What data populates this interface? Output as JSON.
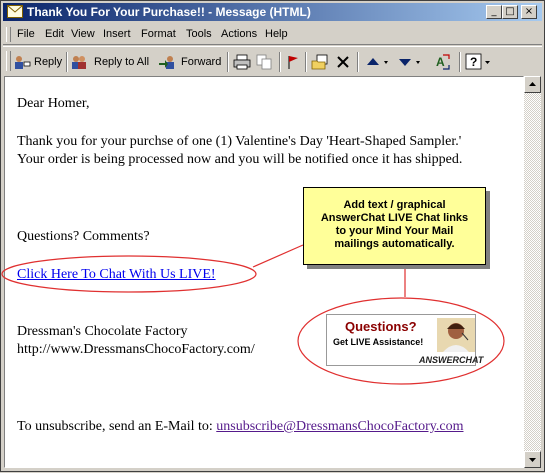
{
  "window": {
    "title": "Thank You For Your Purchase!! - Message (HTML)",
    "controls": {
      "minimize": "_",
      "maximize": "□",
      "close": "×"
    }
  },
  "menu": {
    "items": [
      {
        "label": "File"
      },
      {
        "label": "Edit"
      },
      {
        "label": "View"
      },
      {
        "label": "Insert"
      },
      {
        "label": "Format"
      },
      {
        "label": "Tools"
      },
      {
        "label": "Actions"
      },
      {
        "label": "Help"
      }
    ]
  },
  "toolbar": {
    "reply_label": "Reply",
    "reply_all_label": "Reply to All",
    "forward_label": "Forward",
    "icons": [
      "reply-icon",
      "reply-all-icon",
      "forward-icon",
      "print-icon",
      "copy-icon",
      "flag-icon",
      "move-to-folder-icon",
      "delete-icon",
      "previous-item-icon",
      "next-item-icon",
      "address-book-icon",
      "help-icon"
    ]
  },
  "message": {
    "greeting": "Dear Homer,",
    "body_line1": "Thank you for your purchse of one (1) Valentine's Day 'Heart-Shaped Sampler.'",
    "body_line2": "Your order is being processed now and you will be notified once it has shipped.",
    "questions": "Questions? Comments?",
    "chat_link": "Click Here To Chat With Us LIVE!",
    "company_name": "Dressman's Chocolate Factory",
    "company_url": "http://www.DressmansChocoFactory.com/",
    "unsubscribe_prefix": "To unsubscribe, send an  E-Mail to:",
    "unsubscribe_email": "unsubscribe@DressmansChocoFactory.com"
  },
  "callout": {
    "line1": "Add text / graphical",
    "line2": "AnswerChat LIVE Chat links",
    "line3": "to your Mind Your Mail",
    "line4": "mailings automatically."
  },
  "ad": {
    "headline": "Questions?",
    "subline": "Get LIVE Assistance!",
    "brand": "ANSWERCHAT"
  },
  "colors": {
    "titlebar_start": "#0a246a",
    "titlebar_end": "#a6caf0",
    "highlight_ellipse": "#e03030",
    "callout_bg": "#ffff99",
    "link": "#0000ee",
    "visited_link": "#551a8b"
  }
}
